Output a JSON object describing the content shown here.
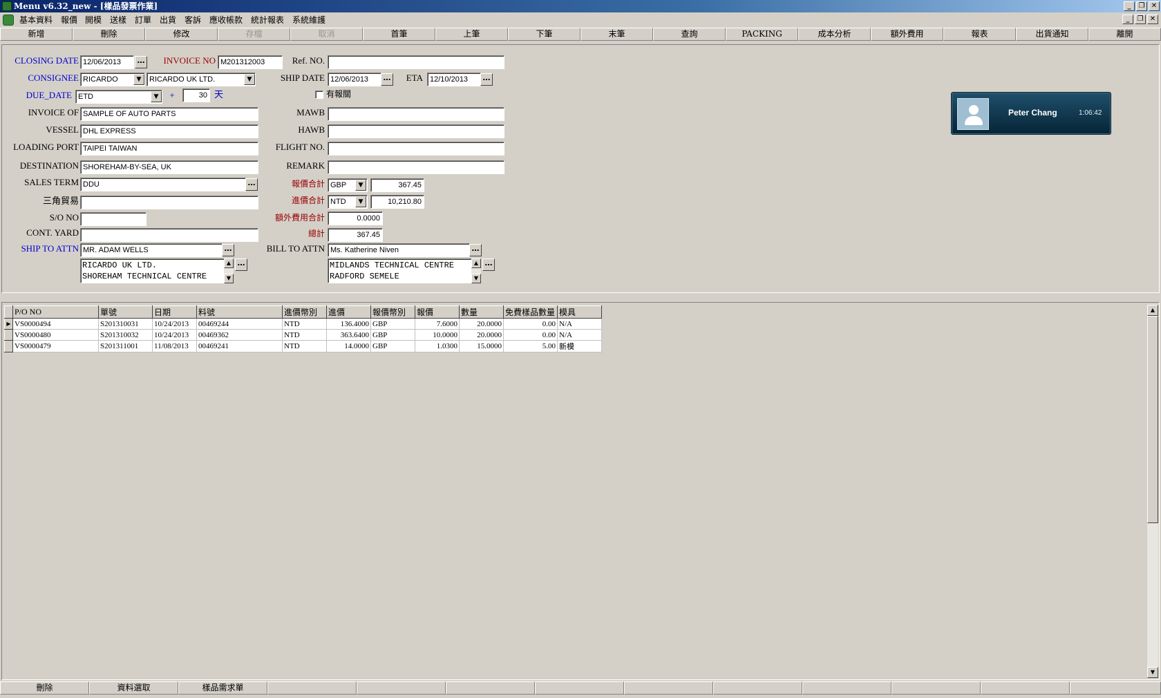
{
  "window": {
    "title": "Menu v6.32_new - [樣品發票作業]"
  },
  "menu": [
    "基本資料",
    "報價",
    "開模",
    "送樣",
    "訂單",
    "出貨",
    "客訴",
    "應收帳款",
    "統計報表",
    "系統維護"
  ],
  "toolbar": [
    "新增",
    "刪除",
    "修改",
    "存檔",
    "取消",
    "首筆",
    "上筆",
    "下筆",
    "末筆",
    "查詢",
    "PACKING",
    "成本分析",
    "額外費用",
    "報表",
    "出貨通知",
    "離開"
  ],
  "toolbar_disabled": [
    "存檔",
    "取消"
  ],
  "form": {
    "closing_date_label": "CLOSING DATE",
    "closing_date": "12/06/2013",
    "invoice_no_label": "INVOICE NO",
    "invoice_no": "M201312003",
    "ref_no_label": "Ref. NO.",
    "ref_no": "",
    "consignee_label": "CONSIGNEE",
    "consignee_code": "RICARDO",
    "consignee_name": "RICARDO UK LTD.",
    "ship_date_label": "SHIP DATE",
    "ship_date": "12/06/2013",
    "eta_label": "ETA",
    "eta": "12/10/2013",
    "due_date_label": "DUE_DATE",
    "due_date_basis": "ETD",
    "plus_sign": "+",
    "due_days": "30",
    "days_unit": "天",
    "customs_label": "有報關",
    "invoice_of_label": "INVOICE OF",
    "invoice_of": "SAMPLE OF AUTO PARTS",
    "mawb_label": "MAWB",
    "mawb": "",
    "vessel_label": "VESSEL",
    "vessel": "DHL EXPRESS",
    "hawb_label": "HAWB",
    "hawb": "",
    "loading_port_label": "LOADING PORT",
    "loading_port": "TAIPEI TAIWAN",
    "flight_no_label": "FLIGHT NO.",
    "flight_no": "",
    "destination_label": "DESTINATION",
    "destination": "SHOREHAM-BY-SEA, UK",
    "remark_label": "REMARK",
    "remark": "",
    "sales_term_label": "SALES TERM",
    "sales_term": "DDU",
    "quote_total_label": "報價合計",
    "quote_currency": "GBP",
    "quote_total": "367.45",
    "triangle_trade_label": "三角貿易",
    "triangle_trade": "",
    "purchase_total_label": "進價合計",
    "purchase_currency": "NTD",
    "purchase_total": "10,210.80",
    "so_no_label": "S/O NO",
    "so_no": "",
    "extra_fee_total_label": "額外費用合計",
    "extra_fee_total": "0.0000",
    "cont_yard_label": "CONT. YARD",
    "cont_yard": "",
    "grand_total_label": "總計",
    "grand_total": "367.45",
    "ship_to_attn_label": "SHIP TO  ATTN",
    "ship_to_attn": "MR. ADAM WELLS",
    "ship_to_line1": "RICARDO UK LTD.",
    "ship_to_line2": "SHOREHAM TECHNICAL CENTRE",
    "bill_to_attn_label": "BILL TO  ATTN",
    "bill_to_attn": "Ms. Katherine Niven",
    "bill_to_line1": "MIDLANDS TECHNICAL CENTRE",
    "bill_to_line2": "RADFORD SEMELE"
  },
  "call": {
    "name": "Peter Chang",
    "duration": "1:06:42"
  },
  "grid": {
    "columns": [
      "P/O NO",
      "單號",
      "日期",
      "料號",
      "進價幣別",
      "進價",
      "報價幣別",
      "報價",
      "數量",
      "免費樣品數量",
      "模具"
    ],
    "rows": [
      [
        "VS0000494",
        "S201310031",
        "10/24/2013",
        "00469244",
        "NTD",
        "136.4000",
        "GBP",
        "7.6000",
        "20.0000",
        "0.00",
        "N/A"
      ],
      [
        "VS0000480",
        "S201310032",
        "10/24/2013",
        "00469362",
        "NTD",
        "363.6400",
        "GBP",
        "10.0000",
        "20.0000",
        "0.00",
        "N/A"
      ],
      [
        "VS0000479",
        "S201311001",
        "11/08/2013",
        "00469241",
        "NTD",
        "14.0000",
        "GBP",
        "1.0300",
        "15.0000",
        "5.00",
        "新模"
      ]
    ]
  },
  "bottom_buttons": [
    "刪除",
    "資料選取",
    "樣品需求單"
  ],
  "icons": {
    "window_icon": "app-icon",
    "minimize": "minimize-icon",
    "restore": "restore-icon",
    "close": "close-icon",
    "ellipsis": "ellipsis-icon",
    "dropdown": "chevron-down-icon",
    "avatar": "user-icon"
  },
  "colors": {
    "title_bar": "#0a246a",
    "label_blue": "#0000cc",
    "label_red": "#990000",
    "face": "#d4d0c8",
    "call_card": "#062536"
  }
}
